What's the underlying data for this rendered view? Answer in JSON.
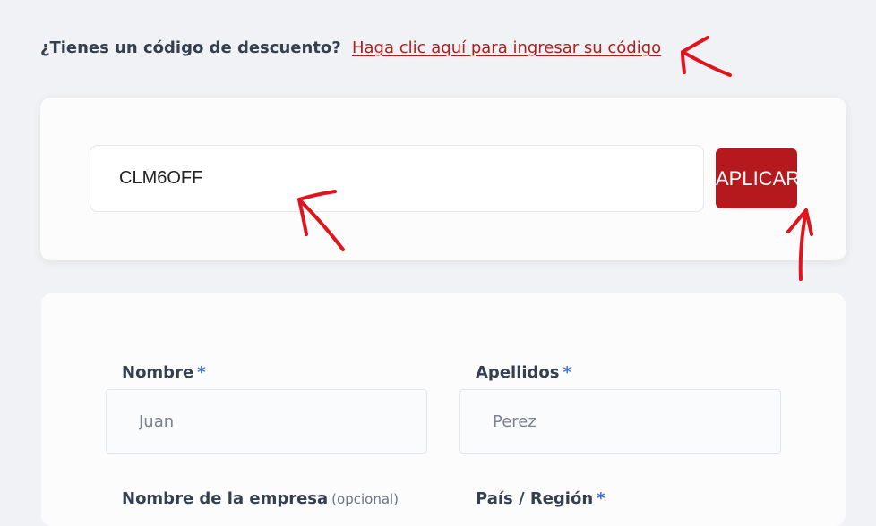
{
  "coupon_notice": {
    "question": "¿Tienes un código de descuento?",
    "link_text": "Haga clic aquí para ingresar su código"
  },
  "coupon_form": {
    "code_value": "CLM6OFF",
    "apply_label": "APLICAR"
  },
  "billing_form": {
    "first_name": {
      "label": "Nombre",
      "required_mark": "*",
      "placeholder": "Juan"
    },
    "last_name": {
      "label": "Apellidos",
      "required_mark": "*",
      "placeholder": "Perez"
    },
    "company": {
      "label": "Nombre de la empresa",
      "optional_text": "(opcional)"
    },
    "country": {
      "label": "País / Región",
      "required_mark": "*"
    }
  },
  "colors": {
    "accent": "#b5191d",
    "required": "#3f6fd0",
    "annotation": "#e0141c"
  }
}
